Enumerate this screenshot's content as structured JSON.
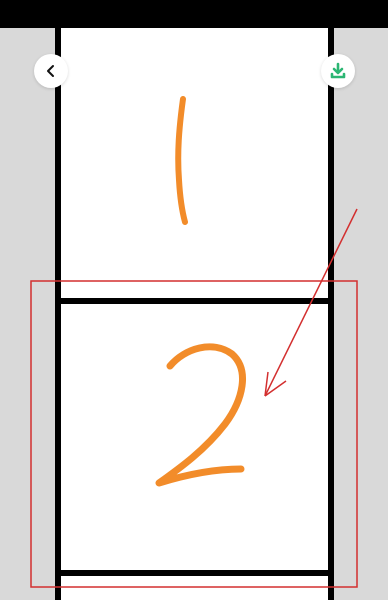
{
  "viewer": {
    "status_bar_color": "#000000",
    "background_color": "#d9d9d9",
    "strip_border_color": "#000000",
    "digit_color": "#f28c2a",
    "annotation_color": "#d32f2f",
    "accent_color": "#2bb673"
  },
  "frames": [
    {
      "number": "1"
    },
    {
      "number": "2"
    }
  ],
  "icons": {
    "back": "chevron-left-icon",
    "download": "download-icon"
  }
}
